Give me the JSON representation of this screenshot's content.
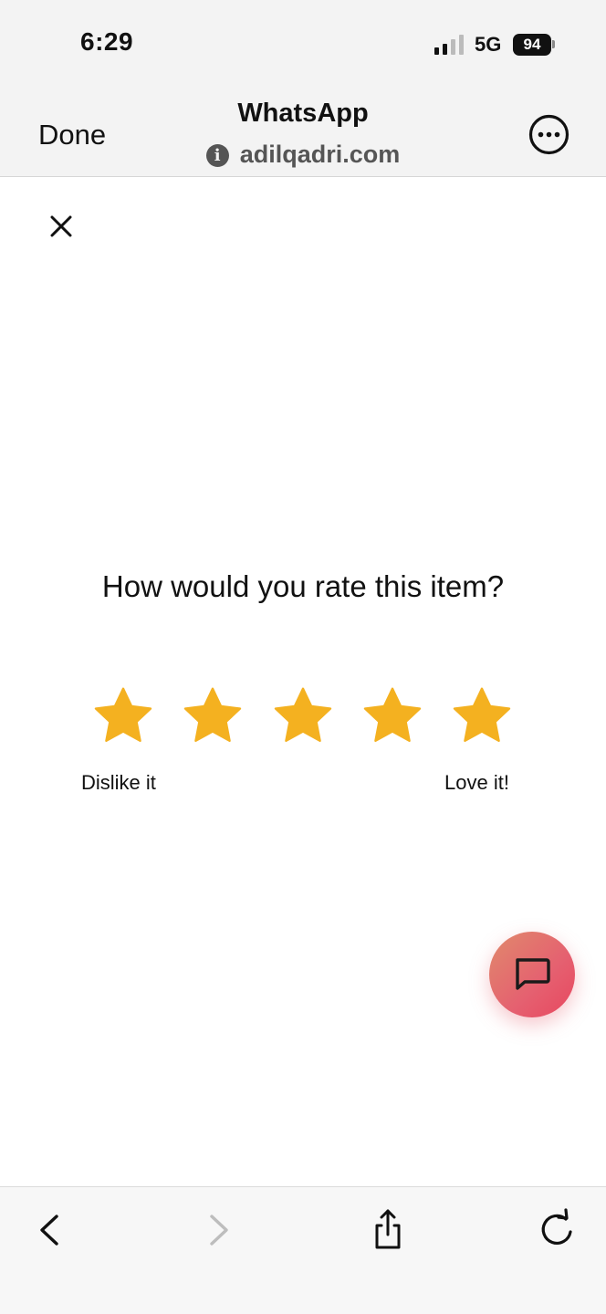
{
  "status_bar": {
    "time": "6:29",
    "network": "5G",
    "battery": "94",
    "icons": [
      "signal-icon",
      "battery-icon"
    ]
  },
  "browser_nav": {
    "done_label": "Done",
    "title": "WhatsApp",
    "url": "adilqadri.com",
    "icons": [
      "info-icon",
      "more-icon"
    ]
  },
  "rating": {
    "question": "How would you rate this item?",
    "star_count": 5,
    "star_color": "#F4B120",
    "low_label": "Dislike it",
    "high_label": "Love it!"
  },
  "fab": {
    "icon": "chat-icon",
    "gradient": [
      "#E08A6C",
      "#E8475F"
    ]
  },
  "toolbar": {
    "icons": [
      "back-icon",
      "forward-icon",
      "share-icon",
      "reload-icon"
    ]
  }
}
